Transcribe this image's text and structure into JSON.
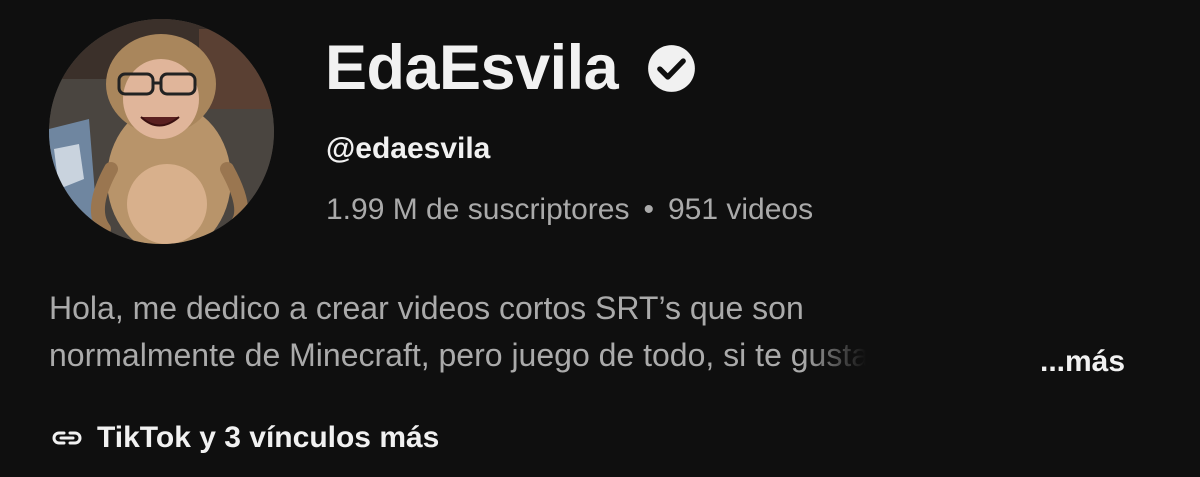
{
  "channel": {
    "name": "EdaEsvila",
    "verified": true,
    "handle": "@edaesvila",
    "subscribers": "1.99 M de suscriptores",
    "separator": "•",
    "videos": "951 videos"
  },
  "description": {
    "line1": "Hola, me dedico a crear videos cortos SRT’s que son",
    "line2": "normalmente de Minecraft, pero juego de todo, si te gusta",
    "more_label": "...más"
  },
  "links": {
    "icon": "link-icon",
    "label": "TikTok y 3 vínculos más"
  },
  "icons": {
    "verified": "verified-check-icon",
    "link": "chain-link-icon"
  },
  "colors": {
    "background": "#0f0f0f",
    "primary_text": "#f1f1f1",
    "secondary_text": "#aaaaaa"
  }
}
